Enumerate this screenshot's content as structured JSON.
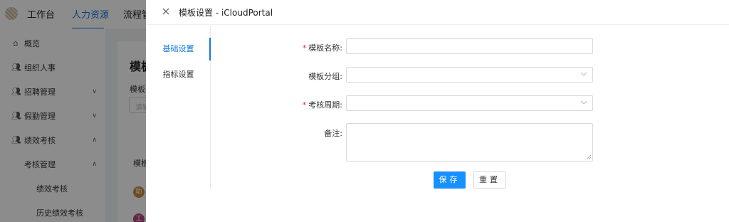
{
  "topbar": {
    "items": [
      "工作台",
      "人力资源",
      "流程管"
    ]
  },
  "sidebar": {
    "items": [
      {
        "label": "概览",
        "icon": "home-icon"
      },
      {
        "label": "组织人事",
        "icon": "users-icon"
      },
      {
        "label": "招聘管理",
        "icon": "users-icon",
        "chevron": "down"
      },
      {
        "label": "假勤管理",
        "icon": "users-icon",
        "chevron": "down"
      },
      {
        "label": "绩效考核",
        "icon": "users-icon",
        "chevron": "up"
      },
      {
        "label": "考核管理",
        "chevron": "up"
      },
      {
        "label": "绩效考核"
      },
      {
        "label": "历史绩效考核"
      }
    ]
  },
  "background": {
    "title": "模板",
    "filter_label": "模板名",
    "filter_placeholder": "请输",
    "column_header": "模板",
    "avatar_1": "助",
    "avatar_2": "工"
  },
  "drawer": {
    "title": "模板设置 - iCloudPortal",
    "tabs": [
      "基础设置",
      "指标设置"
    ],
    "active_tab": "基础设置",
    "form": {
      "name_label": "模板名称:",
      "group_label": "模板分组:",
      "cycle_label": "考核周期:",
      "remark_label": "备注:"
    },
    "buttons": {
      "save": "保存",
      "reset": "重置"
    }
  },
  "colors": {
    "accent": "#1890ff",
    "required": "#f5222d"
  }
}
